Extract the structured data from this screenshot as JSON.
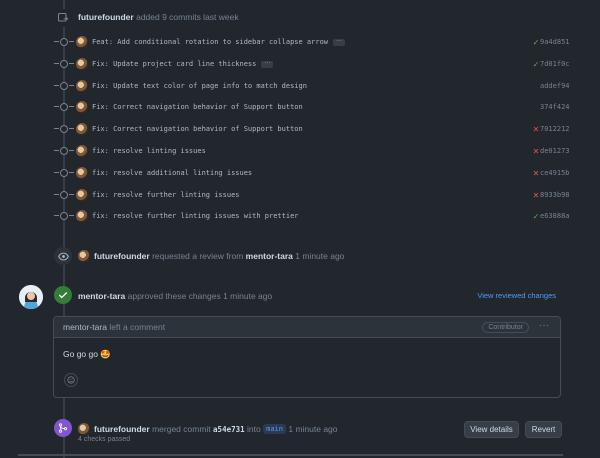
{
  "push_event": {
    "user": "futurefounder",
    "text": "added 9 commits last week"
  },
  "commits": [
    {
      "message": "Feat: Add conditional rotation to sidebar collapse arrow",
      "has_more": true,
      "status": "success",
      "sha": "9a4d851"
    },
    {
      "message": "Fix: Update project card line thickness",
      "has_more": true,
      "status": "success",
      "sha": "7d01f0c"
    },
    {
      "message": "Fix: Update text color of page info to match design",
      "has_more": false,
      "status": "none",
      "sha": "addef94"
    },
    {
      "message": "Fix: Correct navigation behavior of Support button",
      "has_more": false,
      "status": "none",
      "sha": "374f424"
    },
    {
      "message": "Fix: Correct navigation behavior of Support button",
      "has_more": false,
      "status": "failure",
      "sha": "7012212"
    },
    {
      "message": "fix: resolve linting issues",
      "has_more": false,
      "status": "failure",
      "sha": "de01273"
    },
    {
      "message": "fix: resolve additional linting issues",
      "has_more": false,
      "status": "failure",
      "sha": "ce4915b"
    },
    {
      "message": "fix: resolve further linting issues",
      "has_more": false,
      "status": "failure",
      "sha": "8933b98"
    },
    {
      "message": "fix: resolve further linting issues with prettier",
      "has_more": false,
      "status": "success",
      "sha": "e63888a"
    }
  ],
  "review_request": {
    "user": "futurefounder",
    "text": "requested a review from",
    "reviewer": "mentor-tara",
    "time": "1 minute ago"
  },
  "approval": {
    "user": "mentor-tara",
    "text": "approved these changes",
    "time": "1 minute ago",
    "link": "View reviewed changes"
  },
  "comment": {
    "user": "mentor-tara",
    "action": "left a comment",
    "role": "Contributor",
    "more": "···",
    "body": "Go go go",
    "emoji": "🤩"
  },
  "merge": {
    "user": "futurefounder",
    "text": "merged commit",
    "commit": "a54e731",
    "into": "into",
    "branch": "main",
    "time": "1 minute ago",
    "checks": "4 checks passed",
    "view_details": "View details",
    "revert": "Revert"
  },
  "colors": {
    "success": "#57ab5a",
    "failure": "#e5534b",
    "approve_badge": "#347d39",
    "merge_badge": "#8256d0",
    "link": "#539bf5"
  }
}
